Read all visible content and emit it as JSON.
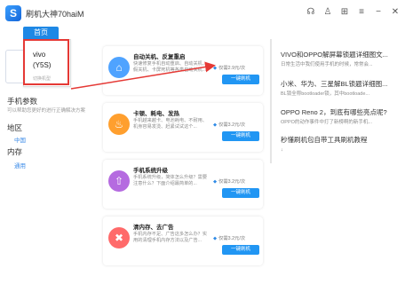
{
  "app": {
    "logo_letter": "S",
    "title": "刷机大神70haiM",
    "tab_home": "首页",
    "window_icons": [
      "headset-icon",
      "shirt-icon",
      "gift-icon",
      "menu-icon",
      "minimize-icon",
      "close-icon"
    ]
  },
  "phone": {
    "brand": "vivo",
    "model": "(Y5S)",
    "switch": "切换机型"
  },
  "left": {
    "params_title": "手机参数",
    "params_sub": "可以帮助您更好的进行正确解决方案",
    "region_title": "地区",
    "region_value": "中国",
    "memory_title": "内存",
    "memory_value": "通用"
  },
  "cards": [
    {
      "title": "自动关机、反复重启",
      "desc": "快速修复手机自动重启、自动关机、假关机、卡屏死机等各类自动关机...",
      "price": "仅需2.9元/次",
      "btn": "一键刷机",
      "color": "#4fa3ff",
      "icon": "⌂"
    },
    {
      "title": "卡顿、耗电、发热",
      "desc": "手机越来越卡、电池耗电、不耐用、机身容易发烫、赶紧试试这个...",
      "price": "仅需3.2元/次",
      "btn": "一键刷机",
      "color": "#ff9f2e",
      "icon": "♨"
    },
    {
      "title": "手机系统升级",
      "desc": "手机系统升级，简体怎么升级？需要注意什么？下面介绍最简单的...",
      "price": "仅需3.2元/次",
      "btn": "一键刷机",
      "color": "#b56be0",
      "icon": "⇧"
    },
    {
      "title": "清内存、去广告",
      "desc": "手机内存不足、广告这多怎么办？实用的清理手机内存方法以及广告...",
      "price": "仅需3.2元/次",
      "btn": "一键刷机",
      "color": "#ff6a6a",
      "icon": "✖"
    }
  ],
  "articles": [
    {
      "title": "VIVO和OPPO解屏幕锁题详细图文...",
      "desc": "日常生活中我们使用手机的时候，常常会..."
    },
    {
      "title": "小米、华为、三星解BL锁题详细图...",
      "desc": "BL锁全称bootloader锁，其中bootloade..."
    },
    {
      "title": "OPPO Reno 2，到底有哪些亮点呢?",
      "desc": "OPPO的动作事件中打了新榜啊的新手机..."
    },
    {
      "title": "秒懂刷机包自带工具刷机教程",
      "desc": "↓"
    }
  ]
}
